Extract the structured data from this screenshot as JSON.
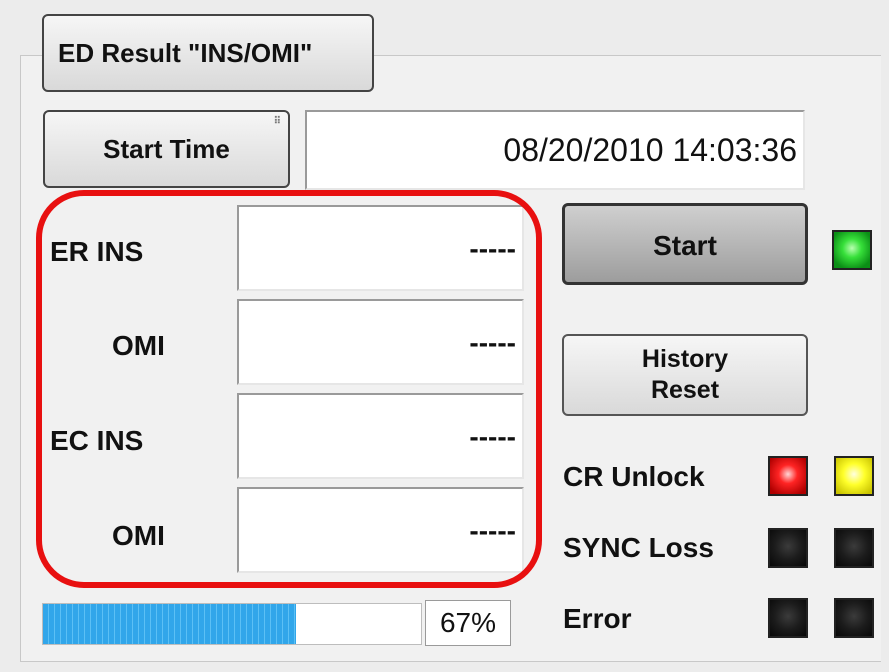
{
  "tab": {
    "label": "ED Result \"INS/OMI\""
  },
  "start_time": {
    "button_label": "Start Time",
    "value": "08/20/2010 14:03:36"
  },
  "results": {
    "er_ins": {
      "label": "ER  INS",
      "value": "-----"
    },
    "er_omi": {
      "label": "OMI",
      "value": "-----"
    },
    "ec_ins": {
      "label": "EC  INS",
      "value": "-----"
    },
    "ec_omi": {
      "label": "OMI",
      "value": "-----"
    }
  },
  "controls": {
    "start_label": "Start",
    "history_reset_line1": "History",
    "history_reset_line2": "Reset",
    "running_led_color": "#22cc22"
  },
  "indicators": {
    "cr_unlock": {
      "label": "CR Unlock",
      "led1": "#ff1a1a",
      "led2": "#ffff1a"
    },
    "sync_loss": {
      "label": "SYNC Loss",
      "led1": "#1a1a1a",
      "led2": "#1a1a1a"
    },
    "error": {
      "label": "Error",
      "led1": "#1a1a1a",
      "led2": "#1a1a1a"
    }
  },
  "progress": {
    "percent": 67,
    "text": "67%"
  },
  "highlight_color": "#e81010"
}
